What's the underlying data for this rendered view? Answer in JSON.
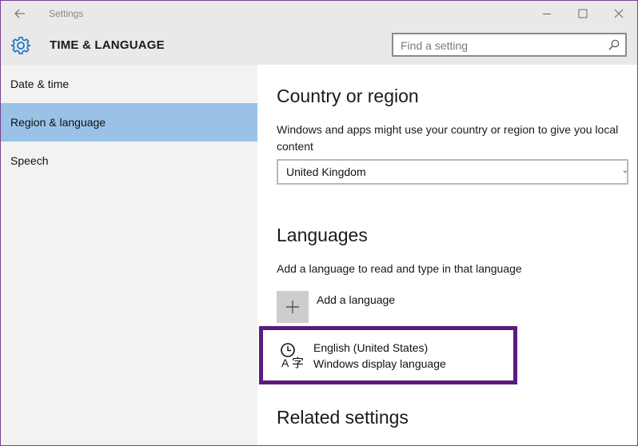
{
  "window": {
    "app_title": "Settings",
    "accent_color": "#99c2e6",
    "highlight_color": "#5a1a80"
  },
  "header": {
    "section_title": "TIME & LANGUAGE",
    "search_placeholder": "Find a setting"
  },
  "sidebar": {
    "items": [
      {
        "label": "Date & time",
        "active": false
      },
      {
        "label": "Region & language",
        "active": true
      },
      {
        "label": "Speech",
        "active": false
      }
    ]
  },
  "main": {
    "country": {
      "heading": "Country or region",
      "description": "Windows and apps might use your country or region to give you local content",
      "selected": "United Kingdom"
    },
    "languages": {
      "heading": "Languages",
      "description": "Add a language to read and type in that language",
      "add_label": "Add a language",
      "items": [
        {
          "name": "English (United States)",
          "subtitle": "Windows display language"
        }
      ]
    },
    "related": {
      "heading": "Related settings"
    }
  },
  "icons": {
    "back": "back-arrow-icon",
    "minimize": "minimize-icon",
    "maximize": "maximize-icon",
    "close": "close-icon",
    "gear": "gear-icon",
    "search": "search-icon",
    "add": "plus-icon",
    "language": "language-icon"
  }
}
